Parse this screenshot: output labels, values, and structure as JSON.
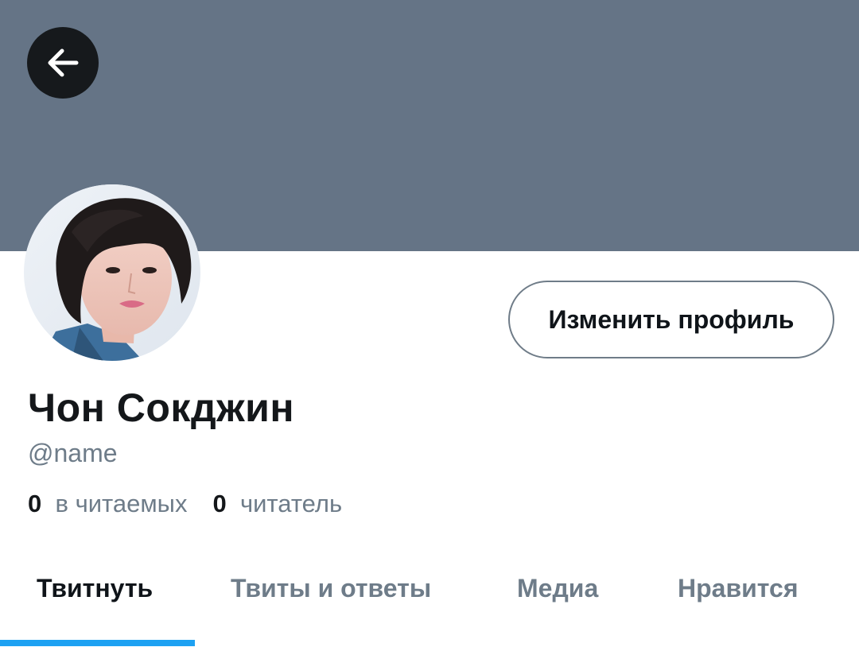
{
  "profile": {
    "display_name": "Чон Сокджин",
    "handle": "@name",
    "edit_button_label": "Изменить профиль",
    "following_count": "0",
    "following_label": "в читаемых",
    "followers_count": "0",
    "followers_label": "читатель"
  },
  "tabs": [
    {
      "label": "Твитнуть",
      "active": true
    },
    {
      "label": "Твиты и ответы",
      "active": false
    },
    {
      "label": "Медиа",
      "active": false
    },
    {
      "label": "Нравится",
      "active": false
    }
  ],
  "icons": {
    "back": "arrow-left-icon"
  },
  "colors": {
    "banner": "#657486",
    "accent": "#1da1f2",
    "secondary_text": "#6e7c89"
  }
}
